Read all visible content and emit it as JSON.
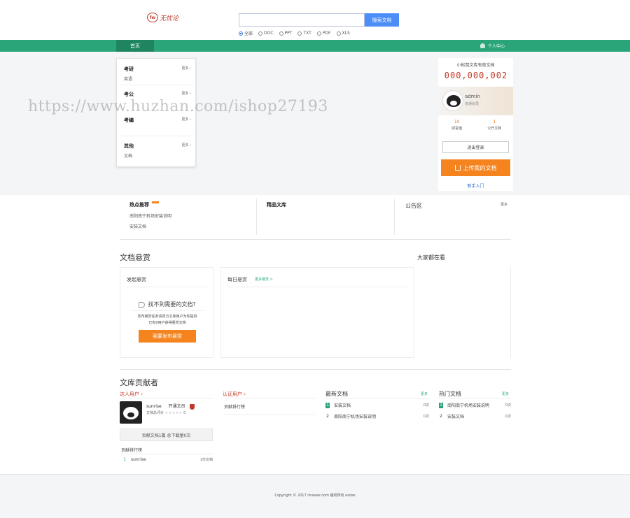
{
  "header": {
    "logo_badge": "fw",
    "logo_text": "无忧论",
    "search_value": "",
    "search_button": "搜索文档",
    "file_types": [
      {
        "label": "全部",
        "checked": true
      },
      {
        "label": "DOC",
        "checked": false
      },
      {
        "label": "PPT",
        "checked": false
      },
      {
        "label": "TXT",
        "checked": false
      },
      {
        "label": "PDF",
        "checked": false
      },
      {
        "label": "XLS",
        "checked": false
      }
    ]
  },
  "nav": {
    "home": "首页",
    "user_center": "个人中心"
  },
  "categories": [
    {
      "title": "考研",
      "more": "更多 ›",
      "sub": "英语"
    },
    {
      "title": "考公",
      "more": "更多 ›",
      "sub": ""
    },
    {
      "title": "考编",
      "more": "更多 ›",
      "sub": ""
    },
    {
      "title": "其他",
      "more": "更多 ›",
      "sub": "文档"
    }
  ],
  "watermark": "https://www.huzhan.com/ishop27193",
  "user_panel": {
    "counter_title": "小松鼠文库有效文档",
    "counter": "000,000,002",
    "name": "admin",
    "level": "普通会员",
    "stats": [
      {
        "num": "10",
        "label": "财富值"
      },
      {
        "num": "1",
        "label": "公开文档"
      }
    ],
    "logout": "退出登录",
    "upload": "上传我的文档",
    "newbie": "新手入门"
  },
  "row2": {
    "hot_title": "热点推荐",
    "hot_items": [
      "南阳南宁机场安装说明",
      "安装文档"
    ],
    "featured_title": "精品文库",
    "notice_title": "公告区",
    "notice_more": "更多"
  },
  "reward": {
    "section_title": "文档悬赏",
    "publish_title": "发起悬赏",
    "cant_find": "找不到需要的文档?",
    "desc_line1": "发布悬赏任务请百万文库用户为你提供",
    "desc_line2": "已有0用户获得悬赏文档",
    "publish_button": "我要发布悬赏",
    "daily_title": "每日悬赏",
    "daily_more": "更多悬赏 >",
    "author_title": "大家都在看"
  },
  "contributors": {
    "section_title": "文库贡献者",
    "tab_expert": "达人用户 ›",
    "tab_verified": "认证用户 ›",
    "user_name": "sunrise",
    "user_badge": "开通文员",
    "user_rating": "文档总评价",
    "stars": "★★★★★",
    "rating_value": "0",
    "contrib_bar": "贡献文档1篇   总下载量0次",
    "rank_title": "贡献排行榜",
    "rank_items": [
      {
        "n": "1",
        "name": "sunrise",
        "count": "1份文档"
      }
    ],
    "verified_rank_title": "贡献排行榜",
    "latest_title": "最新文档",
    "latest_more": "更多",
    "latest": [
      {
        "n": "1",
        "name": "安装文档",
        "v": "0次"
      },
      {
        "n": "2",
        "name": "南阳南宁机场安装说明",
        "v": "0次"
      }
    ],
    "popular_title": "热门文档",
    "popular_more": "更多",
    "popular": [
      {
        "n": "1",
        "name": "南阳南宁机场安装说明",
        "v": "0次"
      },
      {
        "n": "2",
        "name": "安装文档",
        "v": "0次"
      }
    ]
  },
  "footer": {
    "text": "Copyright © 2017 imiaoer.com 版权所有 asdas"
  }
}
